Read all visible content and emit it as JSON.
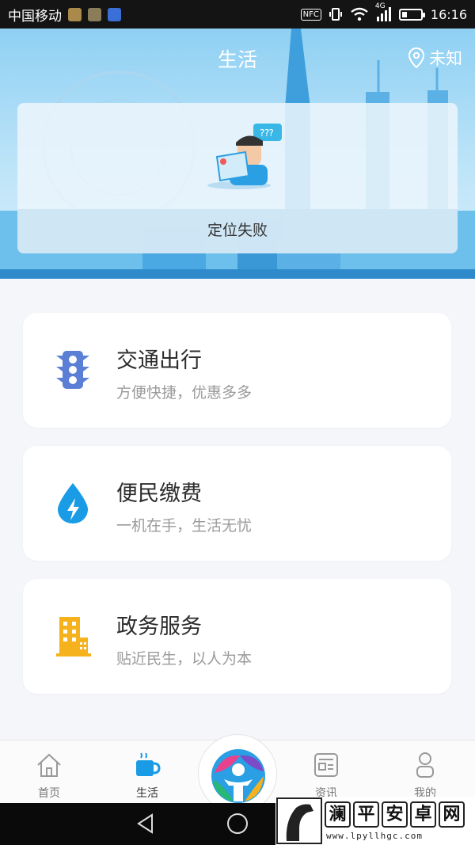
{
  "status_bar": {
    "carrier": "中国移动",
    "network": "4G",
    "nfc": "NFC",
    "time": "16:16"
  },
  "header": {
    "title": "生活",
    "location": "未知",
    "location_icon": "map-pin-icon"
  },
  "location_card": {
    "message": "定位失败"
  },
  "services": [
    {
      "title": "交通出行",
      "subtitle": "方便快捷，优惠多多",
      "icon": "traffic-light-icon",
      "color": "#5b7fd4"
    },
    {
      "title": "便民缴费",
      "subtitle": "一机在手，生活无忧",
      "icon": "water-drop-icon",
      "color": "#1a9be6"
    },
    {
      "title": "政务服务",
      "subtitle": "贴近民生，以人为本",
      "icon": "building-icon",
      "color": "#f5b21d"
    }
  ],
  "tabbar": {
    "items": [
      {
        "label": "首页",
        "icon": "home-icon"
      },
      {
        "label": "生活",
        "icon": "coffee-cup-icon",
        "active": true
      },
      {
        "label": "资讯",
        "icon": "news-icon"
      },
      {
        "label": "我的",
        "icon": "person-icon"
      }
    ]
  },
  "watermark": {
    "chars": [
      "澜",
      "平",
      "安",
      "卓",
      "网"
    ],
    "url": "www.lpyllhgc.com"
  }
}
